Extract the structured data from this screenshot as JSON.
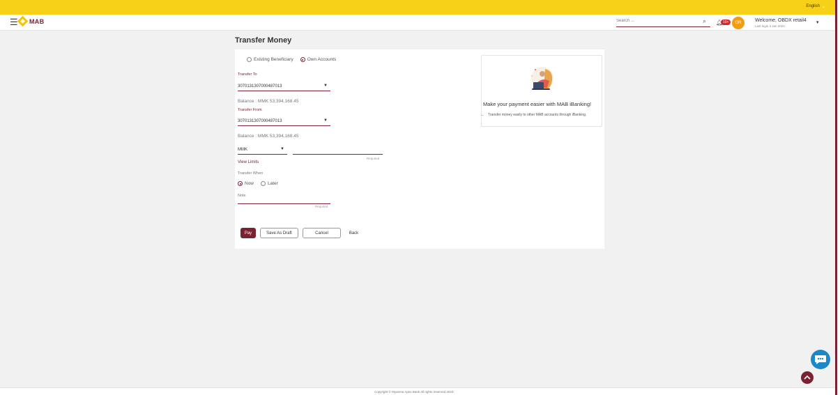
{
  "topbar": {
    "language": "English"
  },
  "header": {
    "brand": "MAB",
    "search_placeholder": "Search ...",
    "notification_count": "10+",
    "avatar_initials": "OR",
    "welcome": "Welcome, OBDX retail4",
    "last_login": "Last login 3 Jan 2024"
  },
  "page": {
    "title": "Transfer Money"
  },
  "form": {
    "payee_type_options": [
      "Existing Beneficiary",
      "Own Accounts"
    ],
    "payee_type_selected": "Own Accounts",
    "transfer_to_label": "Transfer To",
    "transfer_to_value": "3070131307000487013",
    "transfer_to_balance": "Balance : MMK 53,394,168.45",
    "transfer_from_label": "Transfer From",
    "transfer_from_value": "3070131307000487013",
    "transfer_from_balance": "Balance : MMK 53,394,168.45",
    "currency_value": "MMK",
    "amount_required": "Required",
    "view_limits": "View Limits",
    "transfer_when_label": "Transfer When",
    "transfer_when_options": [
      "Now",
      "Later"
    ],
    "transfer_when_selected": "Now",
    "note_placeholder": "Note",
    "note_required": "Required"
  },
  "actions": {
    "pay": "Pay",
    "save_draft": "Save As Draft",
    "cancel": "Cancel",
    "back": "Back"
  },
  "promo": {
    "title": "Make your payment easier with MAB iBanking!",
    "bullet": "Transfer money easily to other MAB accounts through iBanking."
  },
  "footer": {
    "copyright": "Copyright © Myanma Apex Bank All rights reserved 2023."
  },
  "colors": {
    "brand_maroon": "#7a2232",
    "topbar_yellow": "#f7d117",
    "chat_blue": "#1e88c7",
    "avatar_orange": "#f39c12"
  }
}
